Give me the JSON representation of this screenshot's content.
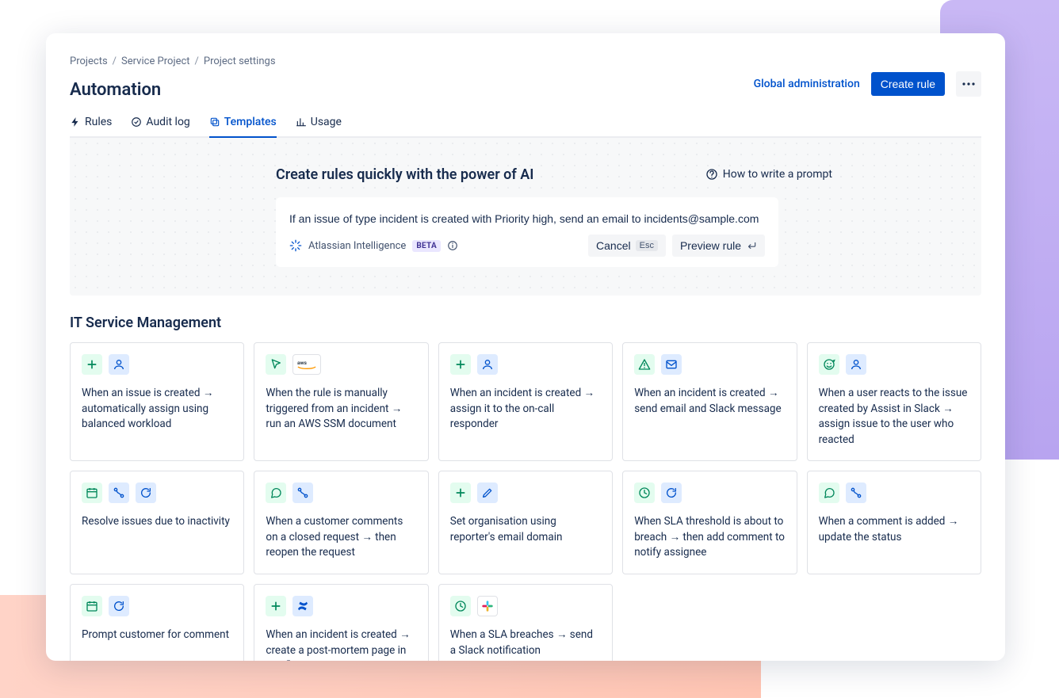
{
  "breadcrumbs": [
    "Projects",
    "Service Project",
    "Project settings"
  ],
  "page_title": "Automation",
  "header": {
    "global_admin": "Global administration",
    "create_rule": "Create rule"
  },
  "tabs": [
    {
      "id": "rules",
      "label": "Rules"
    },
    {
      "id": "audit",
      "label": "Audit log"
    },
    {
      "id": "templates",
      "label": "Templates",
      "active": true
    },
    {
      "id": "usage",
      "label": "Usage"
    }
  ],
  "ai": {
    "heading": "Create rules quickly with the power of AI",
    "help_label": "How to write a prompt",
    "input_value": "If an issue of type incident is created with Priority high, send an email to incidents@sample.com",
    "brand_label": "Atlassian Intelligence",
    "beta_label": "BETA",
    "cancel_label": "Cancel",
    "cancel_key": "Esc",
    "preview_label": "Preview rule"
  },
  "section_title": "IT Service Management",
  "cards": [
    {
      "icons": [
        [
          "green",
          "plus"
        ],
        [
          "blue",
          "person"
        ]
      ],
      "text": "When an issue is created → automatically assign using balanced workload"
    },
    {
      "icons": [
        [
          "green",
          "cursor"
        ],
        [
          "white",
          "aws"
        ]
      ],
      "text": "When the rule is manually triggered from an incident → run an AWS SSM document"
    },
    {
      "icons": [
        [
          "green",
          "plus"
        ],
        [
          "blue",
          "person"
        ]
      ],
      "text": "When an incident is created → assign it to the on-call responder"
    },
    {
      "icons": [
        [
          "green",
          "alert"
        ],
        [
          "blue",
          "mail"
        ]
      ],
      "text": "When an incident is created → send email and Slack message"
    },
    {
      "icons": [
        [
          "green",
          "emoji"
        ],
        [
          "blue",
          "person"
        ]
      ],
      "text": "When a user reacts to the issue created by Assist in Slack → assign issue to the user who reacted"
    },
    {
      "icons": [
        [
          "green",
          "calendar"
        ],
        [
          "blue",
          "flow"
        ],
        [
          "blue",
          "refresh"
        ]
      ],
      "text": "Resolve issues due to inactivity"
    },
    {
      "icons": [
        [
          "green",
          "comment"
        ],
        [
          "blue",
          "flow"
        ]
      ],
      "text": "When a customer comments on a closed request → then reopen the request"
    },
    {
      "icons": [
        [
          "green",
          "plus"
        ],
        [
          "blue",
          "pencil"
        ]
      ],
      "text": "Set organisation using reporter's email domain"
    },
    {
      "icons": [
        [
          "green",
          "clock"
        ],
        [
          "blue",
          "refresh"
        ]
      ],
      "text": "When SLA threshold is about to breach → then add comment to notify assignee"
    },
    {
      "icons": [
        [
          "green",
          "comment"
        ],
        [
          "blue",
          "flow"
        ]
      ],
      "text": "When a comment is added → update the status"
    },
    {
      "icons": [
        [
          "green",
          "calendar"
        ],
        [
          "blue",
          "refresh"
        ]
      ],
      "text": "Prompt customer for comment"
    },
    {
      "icons": [
        [
          "green",
          "plus"
        ],
        [
          "blue",
          "confluence"
        ]
      ],
      "text": "When an incident is created → create a post-mortem page in Confluence"
    },
    {
      "icons": [
        [
          "green",
          "clock"
        ],
        [
          "white",
          "slack"
        ]
      ],
      "text": "When a SLA breaches → send a Slack notification"
    }
  ]
}
